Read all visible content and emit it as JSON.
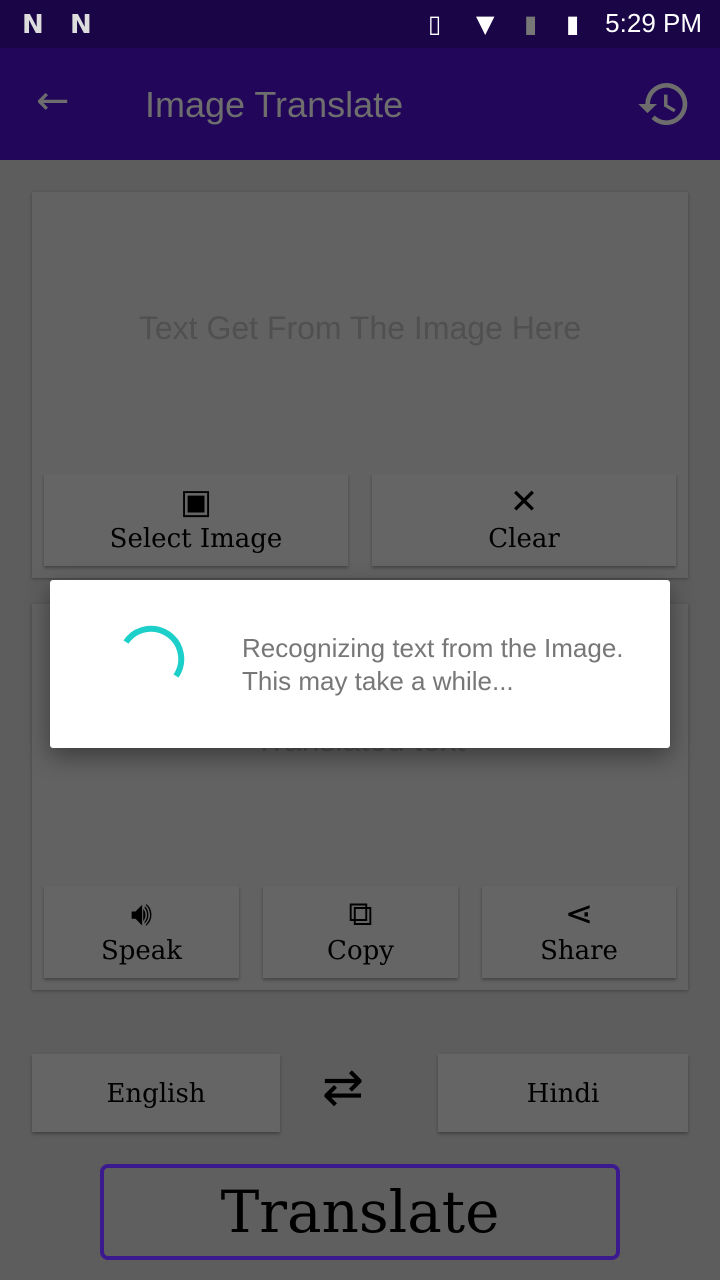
{
  "status_bar": {
    "time": "5:29 PM",
    "icons": [
      "n-notification-icon",
      "n-notification-icon",
      "vibrate-icon",
      "wifi-icon",
      "no-sim-icon",
      "battery-charging-icon"
    ]
  },
  "app_bar": {
    "title": "Image Translate",
    "back_icon": "arrow-back-icon",
    "history_icon": "history-icon"
  },
  "source_card": {
    "placeholder": "Text Get From The Image Here",
    "select_image": "Select Image",
    "clear": "Clear"
  },
  "translated_card": {
    "placeholder": "Translated text",
    "speak": "Speak",
    "copy": "Copy",
    "share": "Share"
  },
  "languages": {
    "source": "English",
    "target": "Hindi",
    "swap_icon": "swap-arrows-icon"
  },
  "translate_button": "Translate",
  "dialog": {
    "message": "Recognizing text from the Image. This may take a while...",
    "spinner_color": "#1ccfc9"
  },
  "colors": {
    "primary": "#22065a",
    "status_bar": "#1a0546",
    "translate_border": "#3b1a8f"
  }
}
